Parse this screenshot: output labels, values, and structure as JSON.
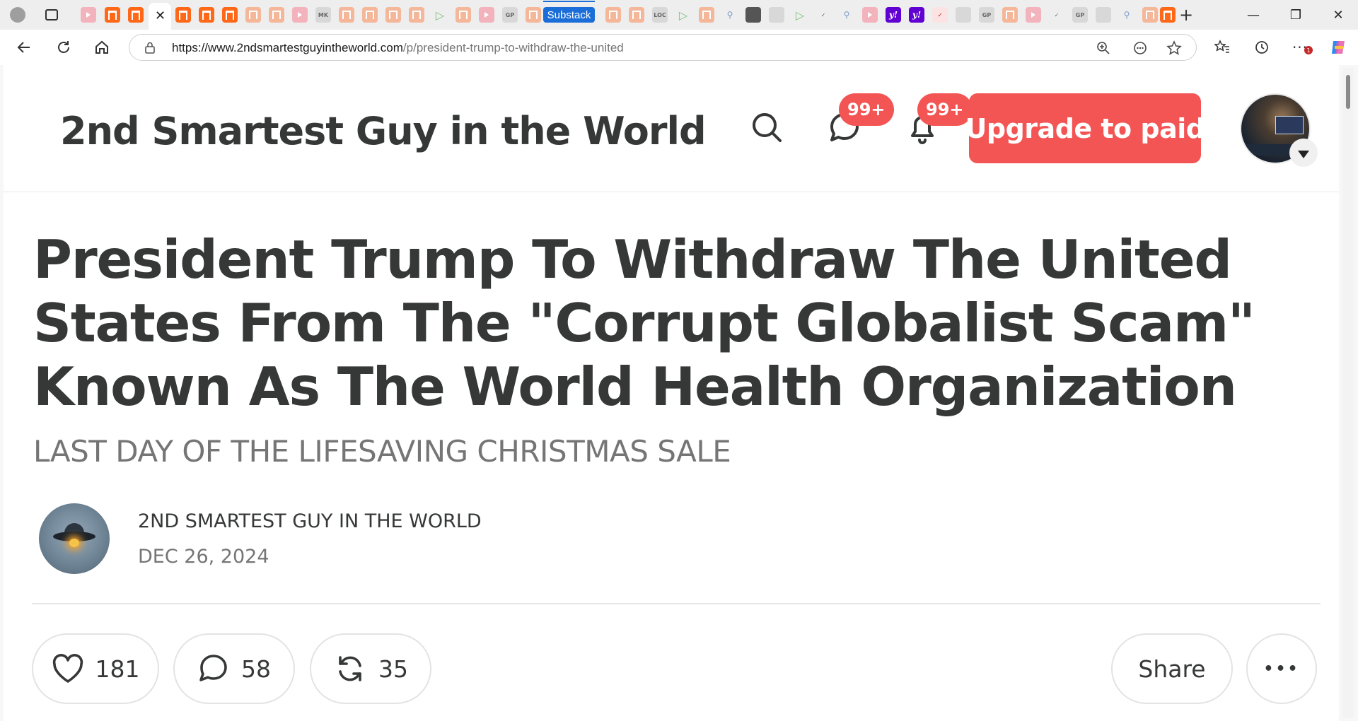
{
  "browser": {
    "active_tab_close": "✕",
    "highlight_tab_label": "Substack",
    "url_host": "https://www.2ndsmartestguyintheworld.com",
    "url_path": "/p/president-trump-to-withdraw-the-united",
    "extensions_badge": "1",
    "tab_labels": {
      "gp": "GP",
      "mk": "MK",
      "loc": "LOC",
      "yahoo": "y!"
    }
  },
  "header": {
    "publication_name": "2nd Smartest Guy in the World",
    "chat_badge": "99+",
    "notifications_badge": "99+",
    "upgrade_label": "Upgrade to paid"
  },
  "post": {
    "title": "President Trump To Withdraw The United States From The \"Corrupt Globalist Scam\" Known As The World Health Organization",
    "subtitle": "LAST DAY OF THE LIFESAVING CHRISTMAS SALE",
    "author": "2ND SMARTEST GUY IN THE WORLD",
    "date": "DEC 26, 2024"
  },
  "actions": {
    "likes": "181",
    "comments": "58",
    "restacks": "35",
    "share_label": "Share",
    "more_label": "•••"
  },
  "colors": {
    "accent": "#f35454",
    "text": "#363737",
    "muted": "#757575",
    "substack_orange": "#ff6719"
  }
}
